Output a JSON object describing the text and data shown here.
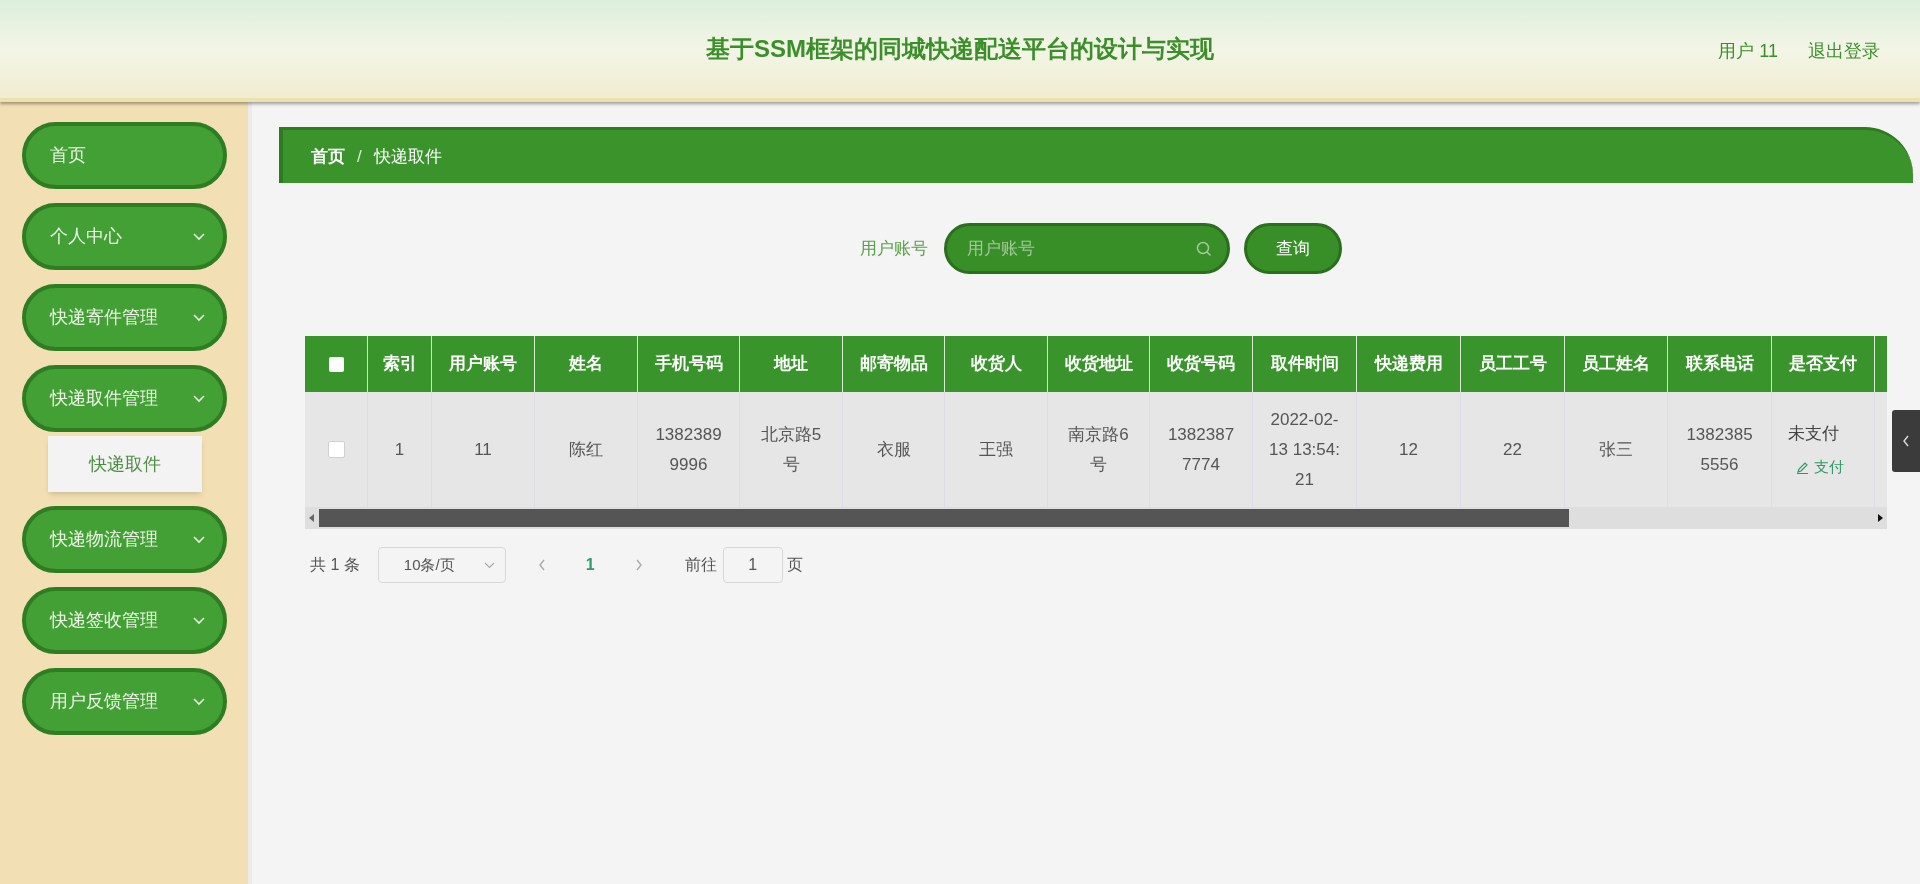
{
  "header": {
    "title": "基于SSM框架的同城快递配送平台的设计与实现",
    "user": "用户 11",
    "logout": "退出登录"
  },
  "sidebar": {
    "items": [
      {
        "label": "首页",
        "has_children": false
      },
      {
        "label": "个人中心",
        "has_children": true
      },
      {
        "label": "快递寄件管理",
        "has_children": true
      },
      {
        "label": "快递取件管理",
        "has_children": true,
        "children": [
          {
            "label": "快递取件"
          }
        ]
      },
      {
        "label": "快递物流管理",
        "has_children": true
      },
      {
        "label": "快递签收管理",
        "has_children": true
      },
      {
        "label": "用户反馈管理",
        "has_children": true
      }
    ]
  },
  "breadcrumb": [
    "首页",
    "快递取件"
  ],
  "breadcrumb_separator": "/",
  "search": {
    "label": "用户账号",
    "placeholder": "用户账号",
    "button": "查询"
  },
  "table": {
    "all_checked": false,
    "columns": [
      "索引",
      "用户账号",
      "姓名",
      "手机号码",
      "地址",
      "邮寄物品",
      "收货人",
      "收货地址",
      "收货号码",
      "取件时间",
      "快递费用",
      "员工工号",
      "员工姓名",
      "联系电话",
      "是否支付"
    ],
    "rows": [
      {
        "checked": false,
        "cells": [
          "1",
          "11",
          "陈红",
          "13823899996",
          "北京路5号",
          "衣服",
          "王强",
          "南京路6号",
          "13823877774",
          "2022-02-13 13:54:21",
          "12",
          "22",
          "张三",
          "13823855556"
        ],
        "pay_status": "未支付",
        "pay_action": "支付"
      }
    ]
  },
  "pagination": {
    "total": "共 1 条",
    "page_size": "10条/页",
    "current": "1",
    "goto_label": "前往",
    "goto_value": "1",
    "goto_suffix": "页"
  }
}
